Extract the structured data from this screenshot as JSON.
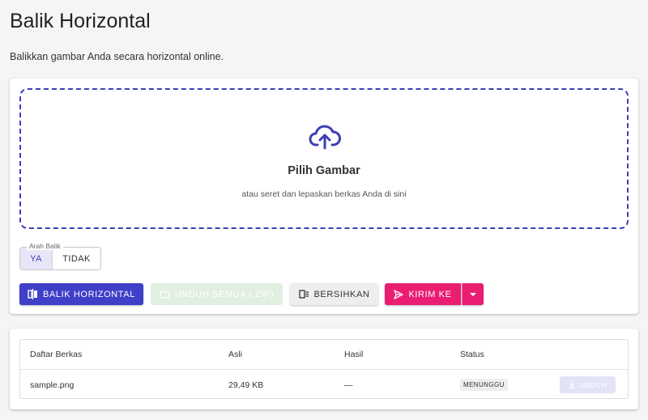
{
  "page": {
    "title": "Balik Horizontal",
    "subtitle": "Balikkan gambar Anda secara horizontal online."
  },
  "dropzone": {
    "icon": "cloud-upload-icon",
    "title": "Pilih Gambar",
    "subtitle": "atau seret dan lepaskan berkas Anda di sini"
  },
  "toggle": {
    "legend": "Arah Balik",
    "options": [
      "YA",
      "TIDAK"
    ],
    "selected": "YA"
  },
  "actions": {
    "flip_label": "BALIK HORIZONTAL",
    "download_all_label": "UNDUH SEMUA (.ZIP)",
    "clear_label": "BERSIHKAN",
    "send_label": "KIRIM KE"
  },
  "files": {
    "headers": [
      "Daftar Berkas",
      "Asli",
      "Hasil",
      "Status"
    ],
    "rows": [
      {
        "name": "sample.png",
        "original": "29,49 KB",
        "result": "—",
        "status": "MENUNGGU",
        "action": "UNDUH"
      }
    ]
  },
  "colors": {
    "primary": "#3f3fc8",
    "accent": "#e91e73",
    "dashed_border": "#3f3fb5"
  }
}
